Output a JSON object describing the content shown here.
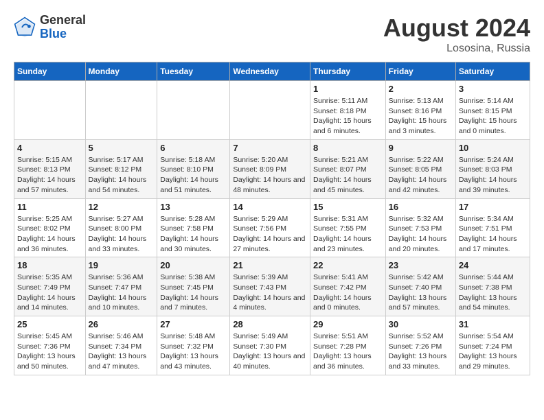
{
  "header": {
    "logo_general": "General",
    "logo_blue": "Blue",
    "main_title": "August 2024",
    "subtitle": "Lososina, Russia"
  },
  "weekdays": [
    "Sunday",
    "Monday",
    "Tuesday",
    "Wednesday",
    "Thursday",
    "Friday",
    "Saturday"
  ],
  "weeks": [
    [
      {
        "day": "",
        "sunrise": "",
        "sunset": "",
        "daylight": ""
      },
      {
        "day": "",
        "sunrise": "",
        "sunset": "",
        "daylight": ""
      },
      {
        "day": "",
        "sunrise": "",
        "sunset": "",
        "daylight": ""
      },
      {
        "day": "",
        "sunrise": "",
        "sunset": "",
        "daylight": ""
      },
      {
        "day": "1",
        "sunrise": "Sunrise: 5:11 AM",
        "sunset": "Sunset: 8:18 PM",
        "daylight": "Daylight: 15 hours and 6 minutes."
      },
      {
        "day": "2",
        "sunrise": "Sunrise: 5:13 AM",
        "sunset": "Sunset: 8:16 PM",
        "daylight": "Daylight: 15 hours and 3 minutes."
      },
      {
        "day": "3",
        "sunrise": "Sunrise: 5:14 AM",
        "sunset": "Sunset: 8:15 PM",
        "daylight": "Daylight: 15 hours and 0 minutes."
      }
    ],
    [
      {
        "day": "4",
        "sunrise": "Sunrise: 5:15 AM",
        "sunset": "Sunset: 8:13 PM",
        "daylight": "Daylight: 14 hours and 57 minutes."
      },
      {
        "day": "5",
        "sunrise": "Sunrise: 5:17 AM",
        "sunset": "Sunset: 8:12 PM",
        "daylight": "Daylight: 14 hours and 54 minutes."
      },
      {
        "day": "6",
        "sunrise": "Sunrise: 5:18 AM",
        "sunset": "Sunset: 8:10 PM",
        "daylight": "Daylight: 14 hours and 51 minutes."
      },
      {
        "day": "7",
        "sunrise": "Sunrise: 5:20 AM",
        "sunset": "Sunset: 8:09 PM",
        "daylight": "Daylight: 14 hours and 48 minutes."
      },
      {
        "day": "8",
        "sunrise": "Sunrise: 5:21 AM",
        "sunset": "Sunset: 8:07 PM",
        "daylight": "Daylight: 14 hours and 45 minutes."
      },
      {
        "day": "9",
        "sunrise": "Sunrise: 5:22 AM",
        "sunset": "Sunset: 8:05 PM",
        "daylight": "Daylight: 14 hours and 42 minutes."
      },
      {
        "day": "10",
        "sunrise": "Sunrise: 5:24 AM",
        "sunset": "Sunset: 8:03 PM",
        "daylight": "Daylight: 14 hours and 39 minutes."
      }
    ],
    [
      {
        "day": "11",
        "sunrise": "Sunrise: 5:25 AM",
        "sunset": "Sunset: 8:02 PM",
        "daylight": "Daylight: 14 hours and 36 minutes."
      },
      {
        "day": "12",
        "sunrise": "Sunrise: 5:27 AM",
        "sunset": "Sunset: 8:00 PM",
        "daylight": "Daylight: 14 hours and 33 minutes."
      },
      {
        "day": "13",
        "sunrise": "Sunrise: 5:28 AM",
        "sunset": "Sunset: 7:58 PM",
        "daylight": "Daylight: 14 hours and 30 minutes."
      },
      {
        "day": "14",
        "sunrise": "Sunrise: 5:29 AM",
        "sunset": "Sunset: 7:56 PM",
        "daylight": "Daylight: 14 hours and 27 minutes."
      },
      {
        "day": "15",
        "sunrise": "Sunrise: 5:31 AM",
        "sunset": "Sunset: 7:55 PM",
        "daylight": "Daylight: 14 hours and 23 minutes."
      },
      {
        "day": "16",
        "sunrise": "Sunrise: 5:32 AM",
        "sunset": "Sunset: 7:53 PM",
        "daylight": "Daylight: 14 hours and 20 minutes."
      },
      {
        "day": "17",
        "sunrise": "Sunrise: 5:34 AM",
        "sunset": "Sunset: 7:51 PM",
        "daylight": "Daylight: 14 hours and 17 minutes."
      }
    ],
    [
      {
        "day": "18",
        "sunrise": "Sunrise: 5:35 AM",
        "sunset": "Sunset: 7:49 PM",
        "daylight": "Daylight: 14 hours and 14 minutes."
      },
      {
        "day": "19",
        "sunrise": "Sunrise: 5:36 AM",
        "sunset": "Sunset: 7:47 PM",
        "daylight": "Daylight: 14 hours and 10 minutes."
      },
      {
        "day": "20",
        "sunrise": "Sunrise: 5:38 AM",
        "sunset": "Sunset: 7:45 PM",
        "daylight": "Daylight: 14 hours and 7 minutes."
      },
      {
        "day": "21",
        "sunrise": "Sunrise: 5:39 AM",
        "sunset": "Sunset: 7:43 PM",
        "daylight": "Daylight: 14 hours and 4 minutes."
      },
      {
        "day": "22",
        "sunrise": "Sunrise: 5:41 AM",
        "sunset": "Sunset: 7:42 PM",
        "daylight": "Daylight: 14 hours and 0 minutes."
      },
      {
        "day": "23",
        "sunrise": "Sunrise: 5:42 AM",
        "sunset": "Sunset: 7:40 PM",
        "daylight": "Daylight: 13 hours and 57 minutes."
      },
      {
        "day": "24",
        "sunrise": "Sunrise: 5:44 AM",
        "sunset": "Sunset: 7:38 PM",
        "daylight": "Daylight: 13 hours and 54 minutes."
      }
    ],
    [
      {
        "day": "25",
        "sunrise": "Sunrise: 5:45 AM",
        "sunset": "Sunset: 7:36 PM",
        "daylight": "Daylight: 13 hours and 50 minutes."
      },
      {
        "day": "26",
        "sunrise": "Sunrise: 5:46 AM",
        "sunset": "Sunset: 7:34 PM",
        "daylight": "Daylight: 13 hours and 47 minutes."
      },
      {
        "day": "27",
        "sunrise": "Sunrise: 5:48 AM",
        "sunset": "Sunset: 7:32 PM",
        "daylight": "Daylight: 13 hours and 43 minutes."
      },
      {
        "day": "28",
        "sunrise": "Sunrise: 5:49 AM",
        "sunset": "Sunset: 7:30 PM",
        "daylight": "Daylight: 13 hours and 40 minutes."
      },
      {
        "day": "29",
        "sunrise": "Sunrise: 5:51 AM",
        "sunset": "Sunset: 7:28 PM",
        "daylight": "Daylight: 13 hours and 36 minutes."
      },
      {
        "day": "30",
        "sunrise": "Sunrise: 5:52 AM",
        "sunset": "Sunset: 7:26 PM",
        "daylight": "Daylight: 13 hours and 33 minutes."
      },
      {
        "day": "31",
        "sunrise": "Sunrise: 5:54 AM",
        "sunset": "Sunset: 7:24 PM",
        "daylight": "Daylight: 13 hours and 29 minutes."
      }
    ]
  ]
}
